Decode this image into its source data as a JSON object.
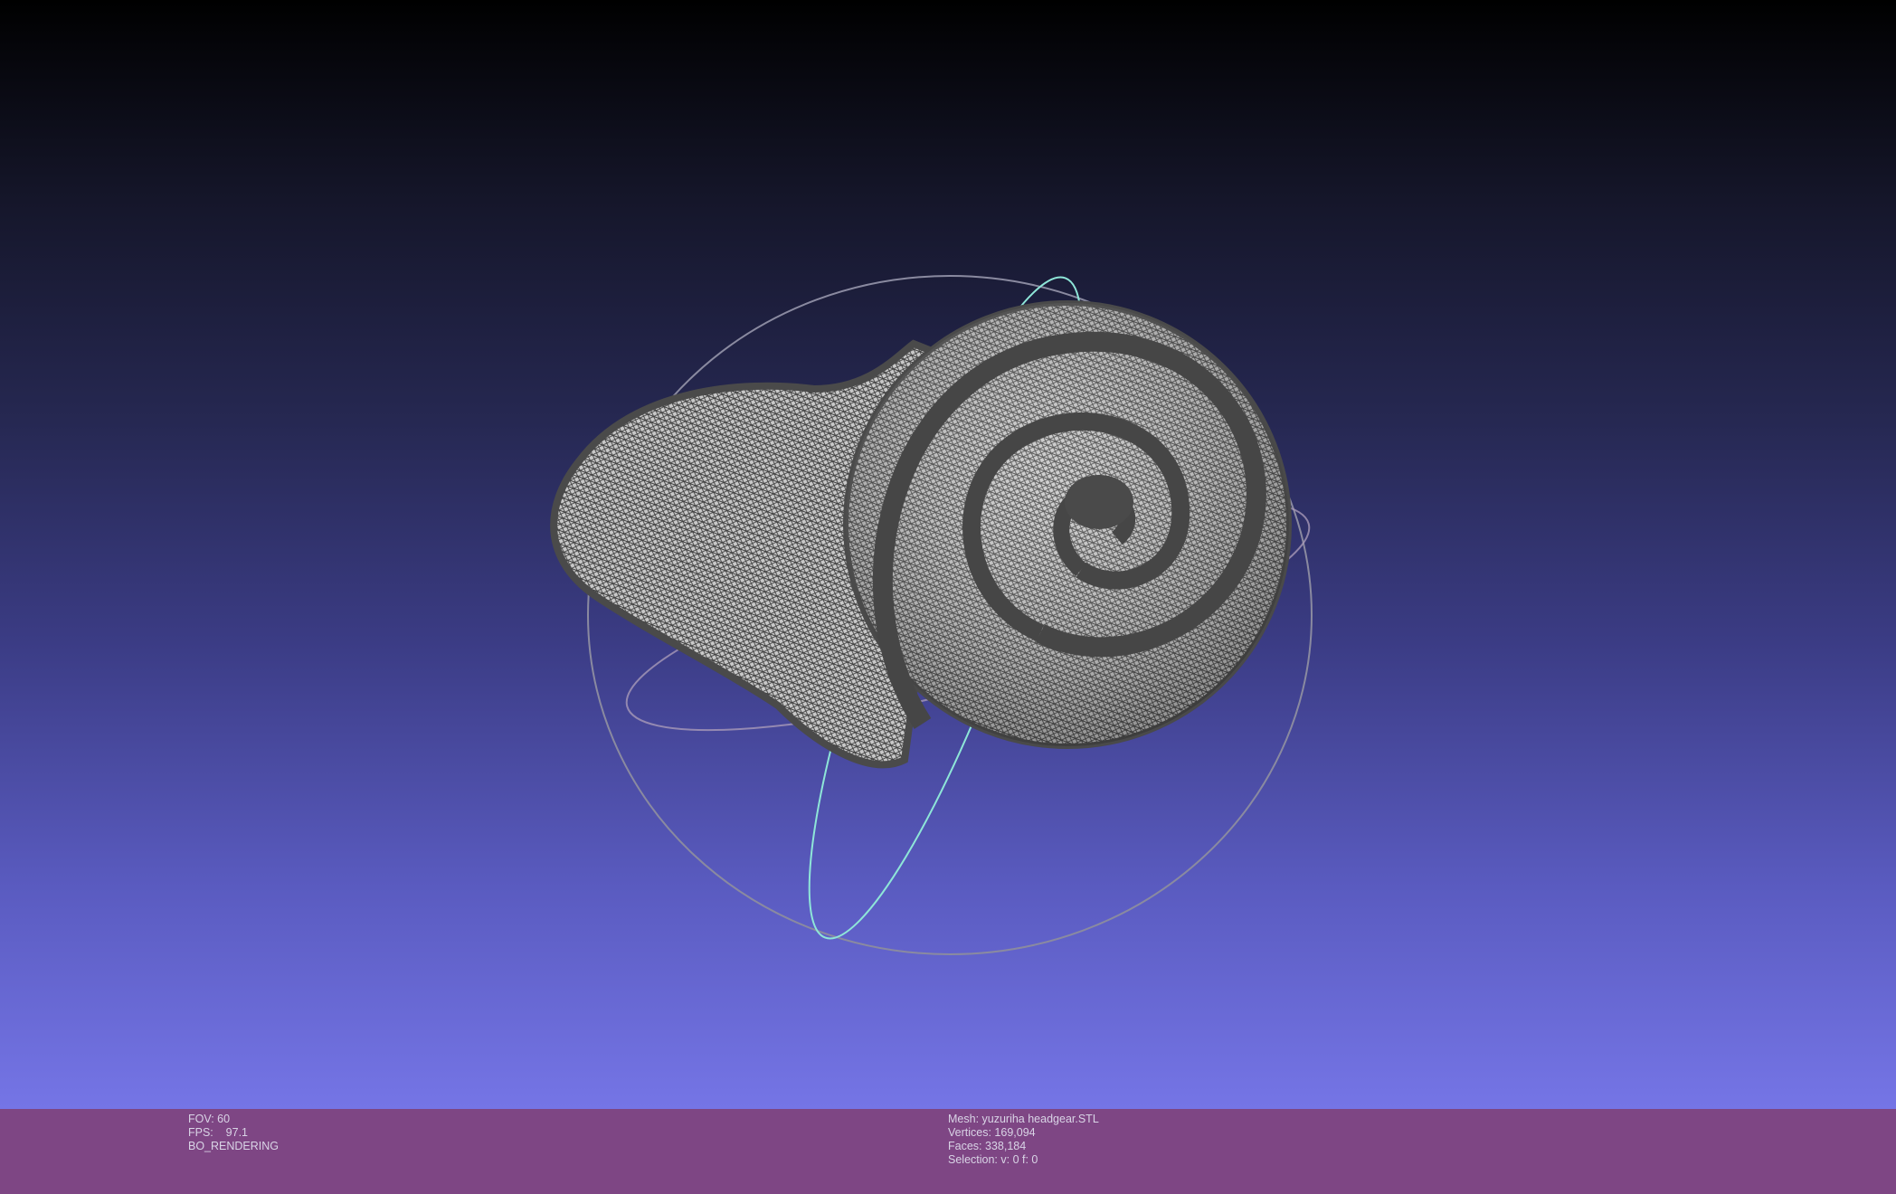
{
  "viewport": {
    "background_top": "#000000",
    "background_bottom": "#7575e6",
    "mesh_fill": "#b9b9b9",
    "mesh_edge": "#4a4a4a",
    "trackball_ring_color": "#8a8aa0",
    "trackball_accent_color": "#8ee6d8"
  },
  "info_left": {
    "fov": "FOV: 60",
    "fps": "FPS:    97.1",
    "mode": "BO_RENDERING"
  },
  "info_right": {
    "mesh": "Mesh: yuzuriha headgear.STL",
    "vertices": "Vertices: 169,094",
    "faces": "Faces: 338,184",
    "selection": "Selection: v: 0 f: 0"
  }
}
